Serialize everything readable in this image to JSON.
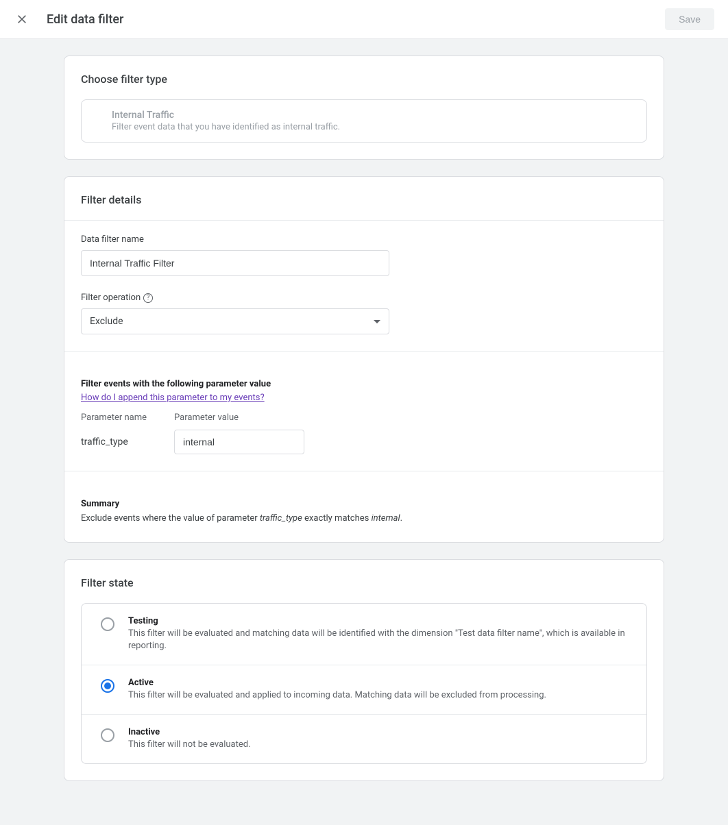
{
  "header": {
    "title": "Edit data filter",
    "save_label": "Save"
  },
  "choose_type": {
    "heading": "Choose filter type",
    "option_title": "Internal Traffic",
    "option_desc": "Filter event data that you have identified as internal traffic."
  },
  "details": {
    "heading": "Filter details",
    "name_label": "Data filter name",
    "name_value": "Internal Traffic Filter",
    "operation_label": "Filter operation",
    "operation_value": "Exclude",
    "param_section_title": "Filter events with the following parameter value",
    "param_help_link": "How do I append this parameter to my events?",
    "param_name_label": "Parameter name",
    "param_name_value": "traffic_type",
    "param_value_label": "Parameter value",
    "param_value_value": "internal",
    "summary_title": "Summary",
    "summary_prefix": "Exclude events where the value of parameter ",
    "summary_param": "traffic_type",
    "summary_mid": " exactly matches ",
    "summary_val": "internal",
    "summary_suffix": "."
  },
  "state": {
    "heading": "Filter state",
    "options": [
      {
        "key": "testing",
        "title": "Testing",
        "desc": "This filter will be evaluated and matching data will be identified with the dimension \"Test data filter name\", which is available in reporting.",
        "selected": false
      },
      {
        "key": "active",
        "title": "Active",
        "desc": "This filter will be evaluated and applied to incoming data. Matching data will be excluded from processing.",
        "selected": true
      },
      {
        "key": "inactive",
        "title": "Inactive",
        "desc": "This filter will not be evaluated.",
        "selected": false
      }
    ]
  }
}
